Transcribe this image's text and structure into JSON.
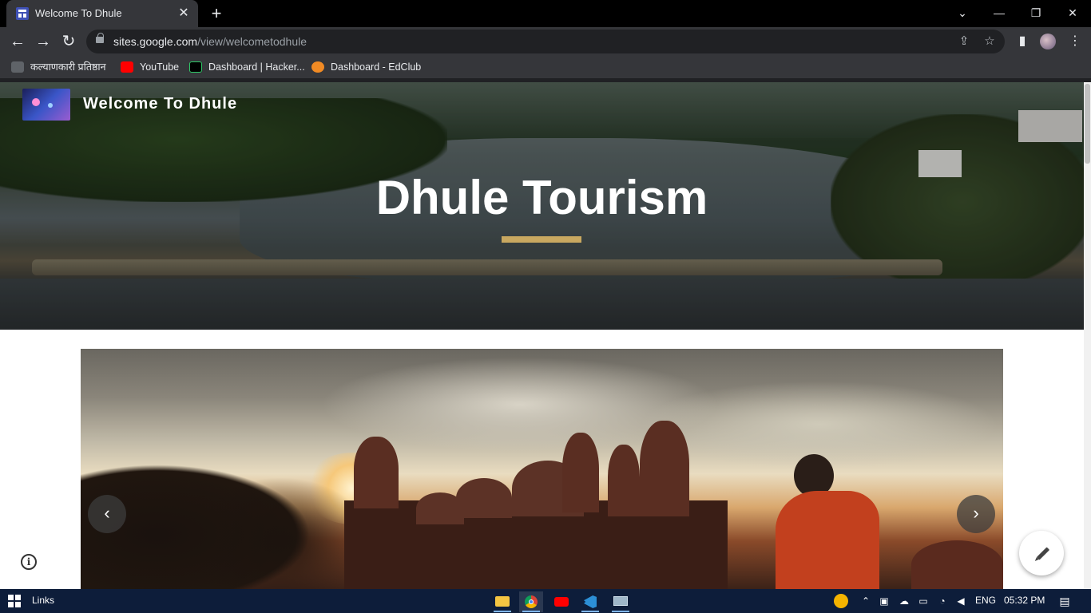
{
  "browser": {
    "tab_title": "Welcome To Dhule",
    "tab_close": "✕",
    "new_tab": "+",
    "window_controls": {
      "minimize": "—",
      "maximize": "❐",
      "close": "✕",
      "tab_search": "⌄"
    },
    "url_host": "sites.google.com",
    "url_path": "/view/welcometodhule",
    "nav": {
      "back": "←",
      "forward": "→",
      "reload": "↻"
    },
    "bookmarks": [
      {
        "label": "कल्याणकारी प्रतिष्ठान",
        "icon": "document-icon",
        "color": "#9aa0a6"
      },
      {
        "label": "YouTube",
        "icon": "youtube-icon",
        "color": "#ff0000"
      },
      {
        "label": "Dashboard | Hacker...",
        "icon": "hackerrank-icon",
        "color": "#000000"
      },
      {
        "label": "Dashboard - EdClub",
        "icon": "edclub-icon",
        "color": "#f08a24"
      }
    ]
  },
  "site": {
    "name": "Welcome To Dhule",
    "hero_title": "Dhule Tourism",
    "accent_color": "#c9a860",
    "carousel": {
      "prev": "‹",
      "next": "›"
    },
    "info_symbol": "i"
  },
  "taskbar": {
    "links_label": "Links",
    "language": "ENG",
    "time": "05:32 PM",
    "apps": [
      "file-explorer-icon",
      "chrome-icon",
      "youtube-icon",
      "vscode-icon",
      "remote-desktop-icon"
    ]
  }
}
